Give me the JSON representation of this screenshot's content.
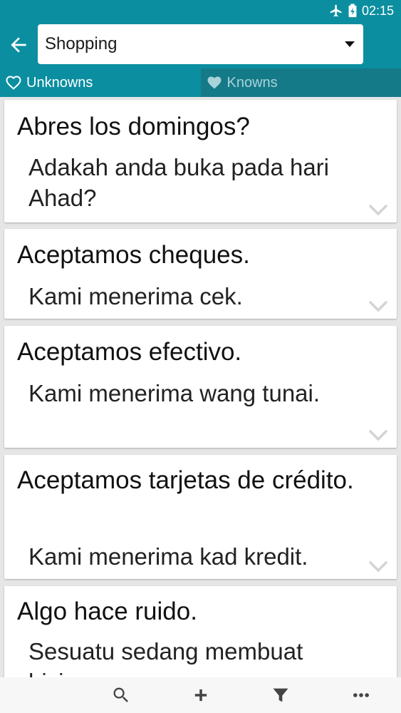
{
  "status": {
    "time": "02:15"
  },
  "header": {
    "category": "Shopping"
  },
  "tabs": [
    {
      "label": "Unknowns"
    },
    {
      "label": "Knowns"
    }
  ],
  "cards": [
    {
      "phrase": "Abres los domingos?",
      "translation": "Adakah anda buka pada hari Ahad?"
    },
    {
      "phrase": "Aceptamos cheques.",
      "translation": "Kami menerima cek."
    },
    {
      "phrase": "Aceptamos efectivo.",
      "translation": "Kami menerima wang tunai."
    },
    {
      "phrase": "Aceptamos tarjetas de crédito.",
      "translation": "Kami menerima kad kredit."
    },
    {
      "phrase": "Algo hace ruido.",
      "translation": "Sesuatu sedang membuat bising."
    }
  ],
  "colors": {
    "primary": "#0b8ea0",
    "tab_inactive": "#157a88",
    "background": "#e6e6e6"
  }
}
